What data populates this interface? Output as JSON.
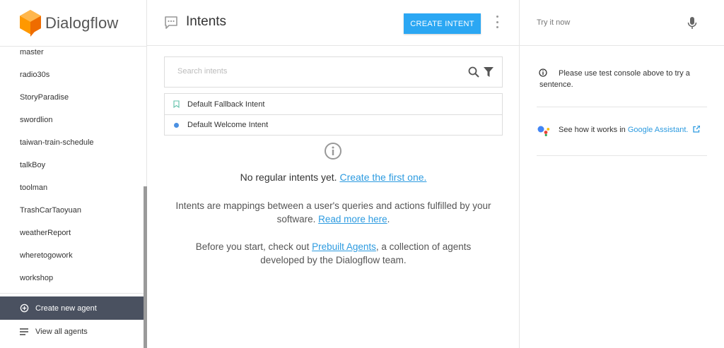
{
  "brand": {
    "name": "Dialogflow"
  },
  "sidebar": {
    "agents": [
      "master",
      "radio30s",
      "StoryParadise",
      "swordlion",
      "taiwan-train-schedule",
      "talkBoy",
      "toolman",
      "TrashCarTaoyuan",
      "weatherReport",
      "wheretogowork",
      "workshop"
    ],
    "create_label": "Create new agent",
    "view_all_label": "View all agents"
  },
  "header": {
    "title": "Intents",
    "create_button": "CREATE INTENT"
  },
  "search": {
    "placeholder": "Search intents"
  },
  "intents": [
    {
      "name": "Default Fallback Intent",
      "marker": "bookmark-icon"
    },
    {
      "name": "Default Welcome Intent",
      "marker": "blue-dot"
    }
  ],
  "empty": {
    "text": "No regular intents yet.",
    "link": "Create the first one."
  },
  "description": {
    "p1_text": "Intents are mappings between a user's queries and actions fulfilled by your software.",
    "p1_link": "Read more here",
    "p1_end": ".",
    "p2_text": "Before you start, check out",
    "p2_link": "Prebuilt Agents",
    "p2_end": ", a collection of agents developed by the Dialogflow team."
  },
  "try_panel": {
    "input_label": "Try it now",
    "hint": "Please use test console above to try a sentence.",
    "ga_text": "See how it works in",
    "ga_link": "Google Assistant."
  },
  "colors": {
    "accent": "#2ba7f3",
    "sidebar_active": "#4a5160",
    "link": "#2d9be0",
    "logo_orange": "#f5a623"
  }
}
